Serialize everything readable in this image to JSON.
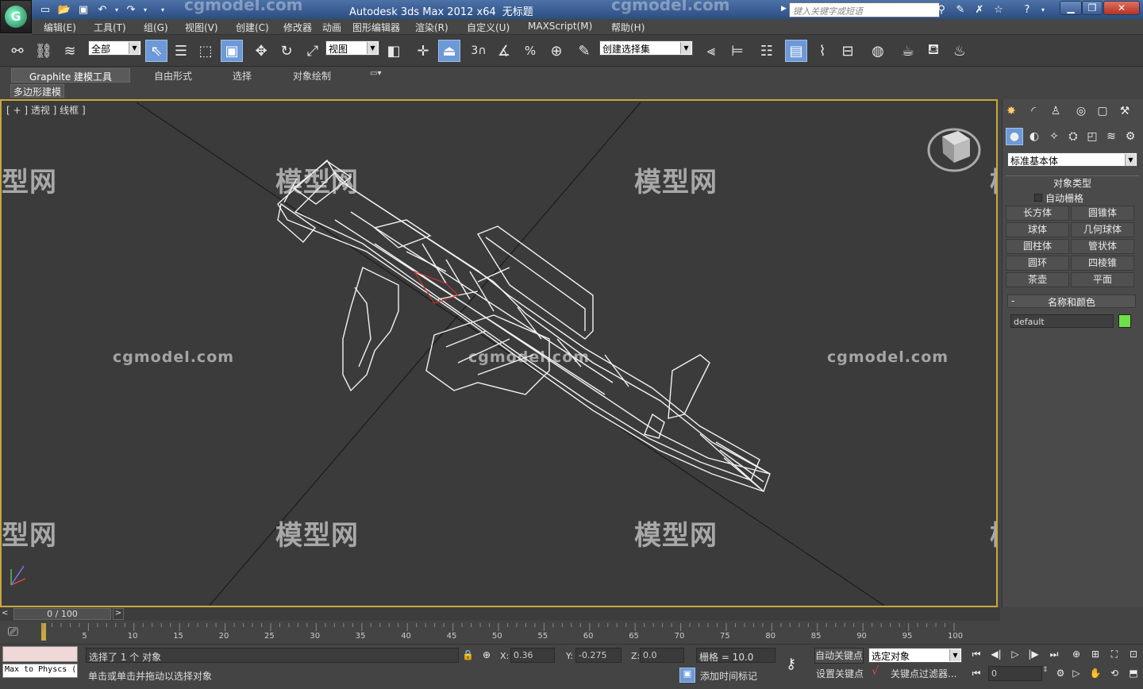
{
  "title": {
    "app_name": "Autodesk 3ds Max  2012 x64",
    "doc_name": "无标题",
    "search_placeholder": "键入关键字或短语",
    "watermark_top": "cgmodel.com"
  },
  "menu": [
    "编辑(E)",
    "工具(T)",
    "组(G)",
    "视图(V)",
    "创建(C)",
    "修改器",
    "动画",
    "图形编辑器",
    "渲染(R)",
    "自定义(U)",
    "MAXScript(M)",
    "帮助(H)"
  ],
  "toolbar": {
    "selection_filter": "全部",
    "ref_coord": "视图",
    "named_selection": "创建选择集",
    "snap_label": "3"
  },
  "ribbon": {
    "tabs": [
      "Graphite 建模工具",
      "自由形式",
      "选择",
      "对象绘制"
    ],
    "panel_label": "多边形建模"
  },
  "viewport": {
    "label": "[ + ] 透视 ] 线框 ]",
    "watermark_cn": "模型网",
    "watermark_en": "cgmodel.com"
  },
  "command_panel": {
    "category": "标准基本体",
    "rollout_object_type": "对象类型",
    "autogrid": "自动栅格",
    "buttons": [
      "长方体",
      "圆锥体",
      "球体",
      "几何球体",
      "圆柱体",
      "管状体",
      "圆环",
      "四棱锥",
      "茶壶",
      "平面"
    ],
    "rollout_name_color": "名称和颜色",
    "object_name": "default",
    "object_color": "#6ee048"
  },
  "timeline": {
    "frame_display": "0 / 100",
    "ticks": [
      "5",
      "10",
      "15",
      "20",
      "25",
      "30",
      "35",
      "40",
      "45",
      "50",
      "55",
      "60",
      "65",
      "70",
      "75",
      "80",
      "85",
      "90",
      "95",
      "100"
    ]
  },
  "status": {
    "script_listener": "Max to Physcs (",
    "selection_info": "选择了 1 个 对象",
    "prompt": "单击或单击并拖动以选择对象",
    "x_label": "X:",
    "x_value": "0.36",
    "y_label": "Y:",
    "y_value": "-0.275",
    "z_label": "Z:",
    "z_value": "0.0",
    "grid": "栅格 = 10.0",
    "auto_key": "自动关键点",
    "set_key": "设置关键点",
    "key_mode": "选定对象",
    "key_filters": "关键点过滤器...",
    "add_time_tag": "添加时间标记",
    "frame_field": "0"
  }
}
